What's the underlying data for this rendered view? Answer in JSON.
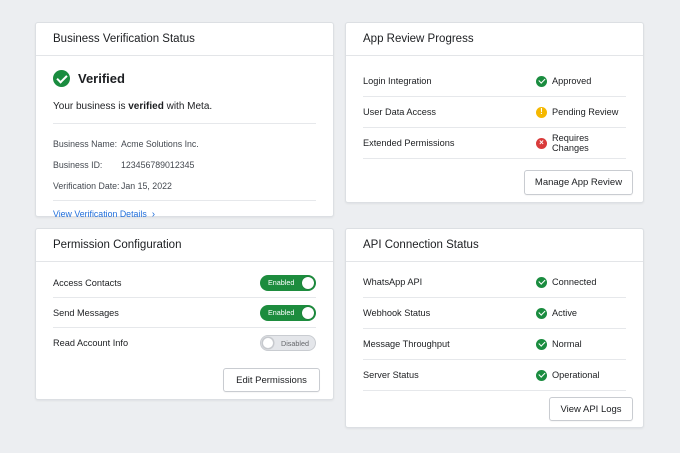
{
  "business_verification": {
    "title": "Business Verification Status",
    "status_label": "Verified",
    "message_prefix": "Your business is ",
    "message_bold": "verified",
    "message_suffix": " with Meta.",
    "fields": [
      {
        "key": "Business Name:",
        "value": "Acme Solutions Inc."
      },
      {
        "key": "Business ID:",
        "value": "123456789012345"
      },
      {
        "key": "Verification Date:",
        "value": "Jan 15, 2022"
      }
    ],
    "link_label": "View Verification Details",
    "link_chevron": "›"
  },
  "app_review": {
    "title": "App Review Progress",
    "items": [
      {
        "name": "Login Integration",
        "status": "Approved",
        "icon": "check-circle-icon"
      },
      {
        "name": "User Data Access",
        "status": "Pending Review",
        "icon": "warning-circle-icon"
      },
      {
        "name": "Extended Permissions",
        "status": "Requires Changes",
        "icon": "error-circle-icon"
      }
    ],
    "button_label": "Manage App Review"
  },
  "permissions": {
    "title": "Permission Configuration",
    "items": [
      {
        "name": "Access Contacts",
        "toggle_label": "Enabled",
        "enabled": true
      },
      {
        "name": "Send Messages",
        "toggle_label": "Enabled",
        "enabled": true
      },
      {
        "name": "Read Account Info",
        "toggle_label": "Disabled",
        "enabled": false
      }
    ],
    "button_label": "Edit Permissions"
  },
  "api_status": {
    "title": "API Connection Status",
    "items": [
      {
        "name": "WhatsApp API",
        "status": "Connected"
      },
      {
        "name": "Webhook Status",
        "status": "Active"
      },
      {
        "name": "Message Throughput",
        "status": "Normal"
      },
      {
        "name": "Server Status",
        "status": "Operational"
      }
    ],
    "button_label": "View API Logs"
  },
  "colors": {
    "success": "#1a8c3f",
    "warning": "#f5b800",
    "error": "#d93b3b",
    "link": "#216fdb",
    "background": "#eceef1"
  }
}
